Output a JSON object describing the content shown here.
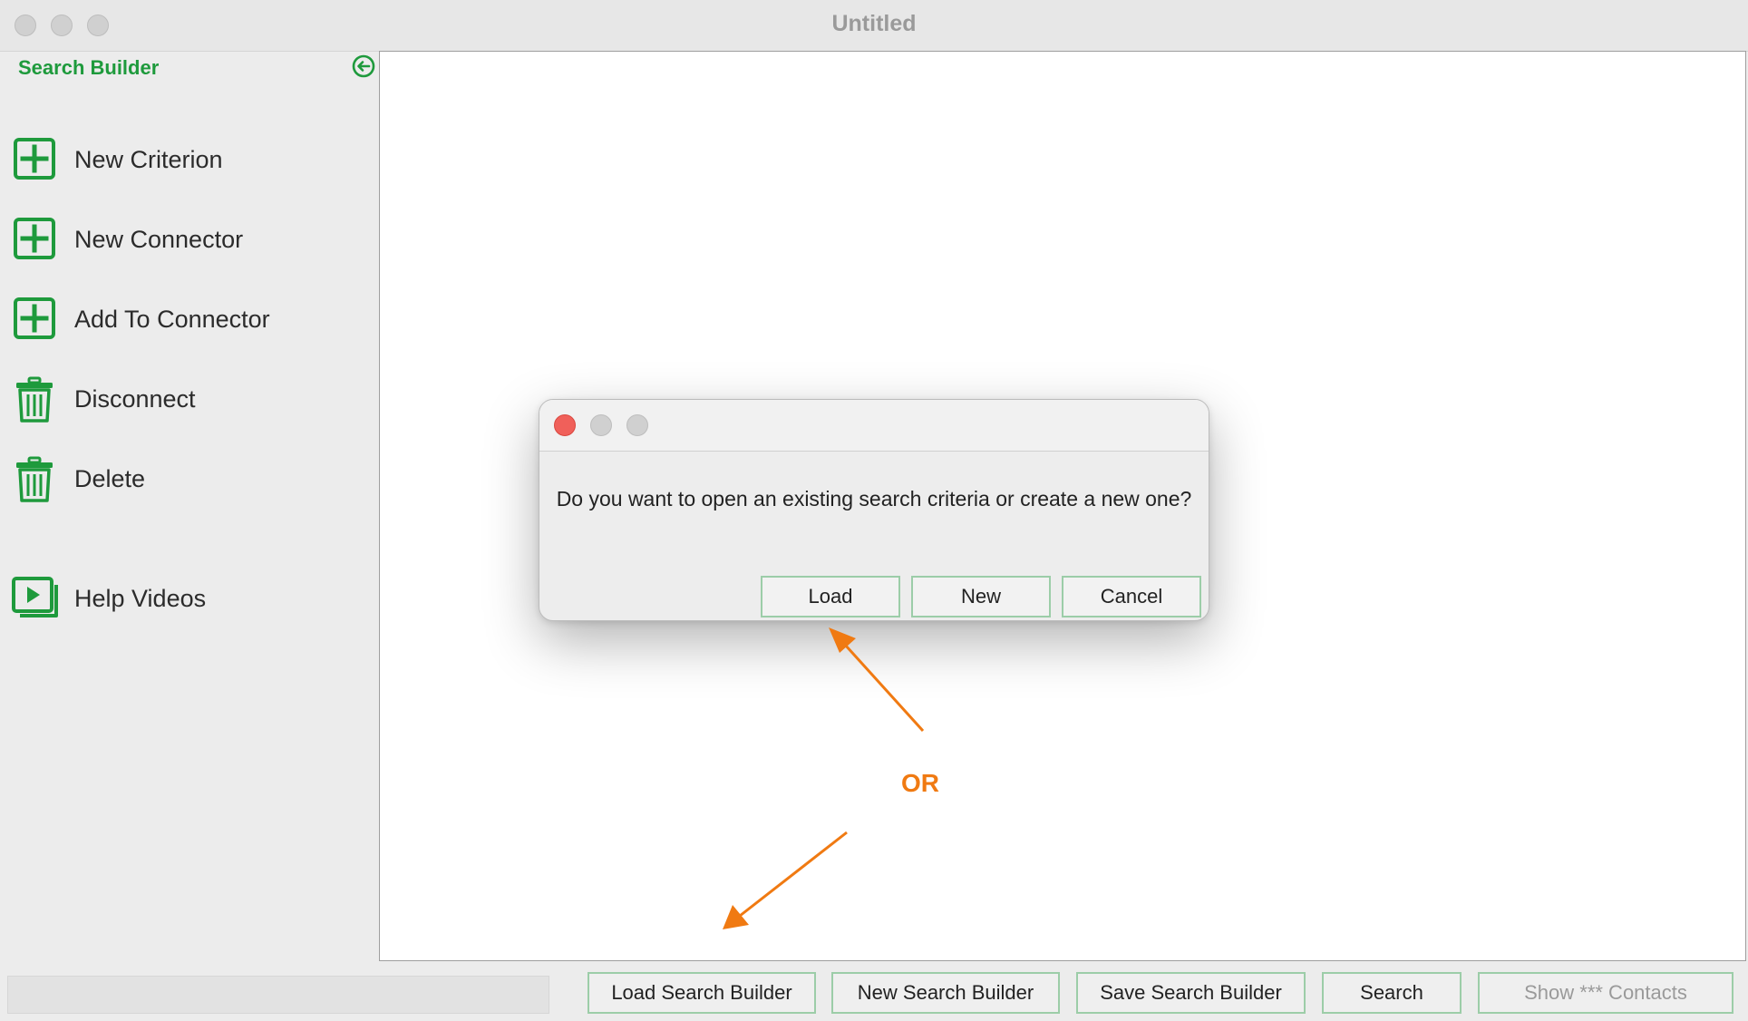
{
  "window": {
    "title": "Untitled"
  },
  "sidebar": {
    "title": "Search Builder",
    "items": [
      {
        "label": "New Criterion",
        "icon": "plus-box-icon"
      },
      {
        "label": "New Connector",
        "icon": "plus-box-icon"
      },
      {
        "label": "Add To Connector",
        "icon": "plus-box-icon"
      },
      {
        "label": "Disconnect",
        "icon": "trash-icon"
      },
      {
        "label": "Delete",
        "icon": "trash-icon"
      },
      {
        "label": "Help Videos",
        "icon": "video-play-icon"
      }
    ]
  },
  "dialog": {
    "message": "Do you want to open an existing search criteria or create a new one?",
    "buttons": {
      "load": "Load",
      "new": "New",
      "cancel": "Cancel"
    }
  },
  "annotation": {
    "or_label": "OR"
  },
  "bottombar": {
    "load_label": "Load Search Builder",
    "new_label": "New Search Builder",
    "save_label": "Save Search Builder",
    "search_label": "Search",
    "show_contacts_label": "Show *** Contacts"
  },
  "colors": {
    "accent_green": "#1e9a3c",
    "button_border": "#9ccda8",
    "annotation_orange": "#f07a12",
    "close_red": "#f0605a"
  }
}
